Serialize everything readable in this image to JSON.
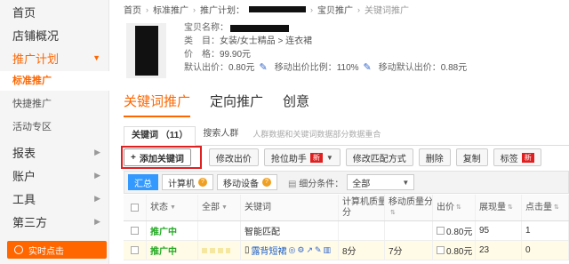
{
  "sidebar": {
    "items": [
      {
        "label": "首页"
      },
      {
        "label": "店铺概况"
      },
      {
        "label": "推广计划"
      },
      {
        "label": "报表"
      },
      {
        "label": "账户"
      },
      {
        "label": "工具"
      },
      {
        "label": "第三方"
      }
    ],
    "sub_items": [
      {
        "label": "标准推广"
      },
      {
        "label": "快捷推广"
      },
      {
        "label": "活动专区"
      }
    ],
    "realtime_label": "实时点击",
    "accent": "#ff6600"
  },
  "breadcrumb": {
    "home": "首页",
    "standard": "标准推广",
    "plan_prefix": "推广计划：",
    "product": "宝贝推广",
    "current": "关键词推广"
  },
  "product": {
    "name_label": "宝贝名称：",
    "category_label": "类　目：",
    "category_value": "女装/女士精品 > 连衣裙",
    "price_label": "价　格：",
    "price_value": "99.90元",
    "default_bid_label": "默认出价：",
    "default_bid_value": "0.80元",
    "mobile_ratio_label": "移动出价比例：",
    "mobile_ratio_value": "110%",
    "mobile_default_label": "移动默认出价：",
    "mobile_default_value": "0.88元"
  },
  "main_tabs": [
    "关键词推广",
    "定向推广",
    "创意"
  ],
  "sub_tabs": {
    "keywords": "关键词 （11）",
    "search_crowd": "搜索人群",
    "hint": "人群数据和关键词数据部分数据重合"
  },
  "toolbar": {
    "add_keyword": "添加关键词",
    "modify_bid": "修改出价",
    "bid_helper": "抢位助手",
    "new_badge": "新",
    "modify_match": "修改匹配方式",
    "delete": "删除",
    "copy": "复制",
    "tag": "标签"
  },
  "filter": {
    "summary": "汇总",
    "computer": "计算机",
    "mobile": "移动设备",
    "segment_label": "细分条件：",
    "segment_value": "全部"
  },
  "table": {
    "headers": {
      "status": "状态",
      "all": "全部",
      "keyword": "关键词",
      "pc_quality_1": "计算机质量",
      "pc_quality_2": "分",
      "mobile_quality_1": "移动质量分",
      "bid": "出价",
      "impressions": "展现量",
      "clicks": "点击量"
    },
    "rows": [
      {
        "status": "推广中",
        "keyword": "智能匹配",
        "pc_quality": "",
        "mobile_quality": "",
        "bid": "0.80元",
        "impressions": "95",
        "clicks": "1"
      },
      {
        "status": "推广中",
        "keyword": "露背短裙",
        "pc_quality": "8分",
        "mobile_quality": "7分",
        "bid": "0.80元",
        "impressions": "23",
        "clicks": "0"
      }
    ]
  }
}
